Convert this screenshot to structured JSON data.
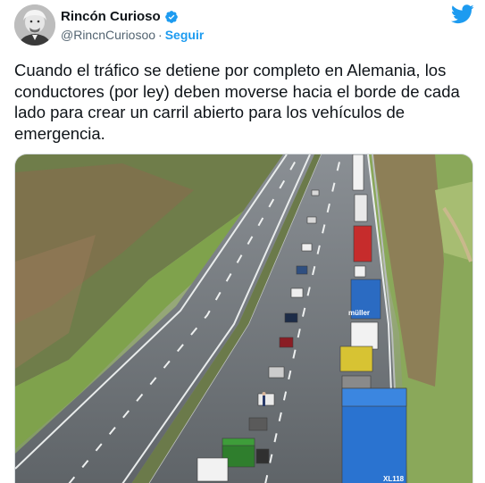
{
  "author": {
    "name": "Rincón Curioso",
    "handle": "@RincnCuriosoo",
    "separator": "·",
    "follow_label": "Seguir",
    "verified_icon": "verified-badge-icon",
    "avatar_icon": "portrait-avatar"
  },
  "platform_icon": "twitter-bird-icon",
  "tweet": {
    "text": "Cuando el tráfico se detiene por completo en Alemania, los conductores (por ley) deben moverse hacia el borde de cada lado para crear un carril abierto para los vehículos de emergencia."
  },
  "photo": {
    "description_icon": "highway-traffic-photo",
    "truck_label": "XL118",
    "truck_brand": "müller"
  },
  "colors": {
    "accent": "#1d9bf0",
    "text": "#0f1419",
    "muted": "#536471"
  }
}
